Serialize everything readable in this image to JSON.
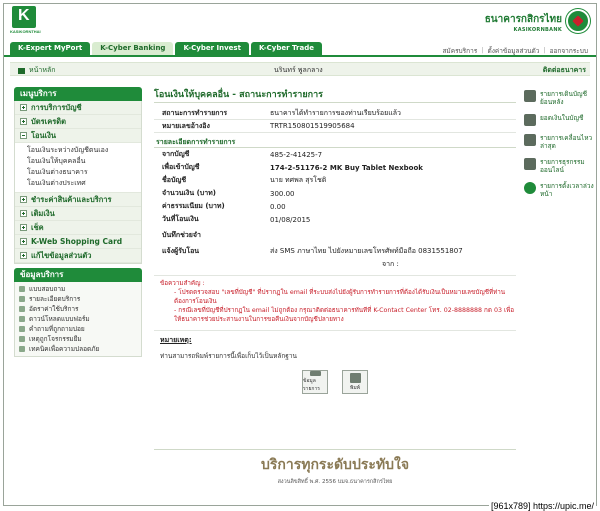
{
  "header": {
    "logo_text": "KASIKORNTHAI",
    "bank_name_th": "ธนาคารกสิกรไทย",
    "bank_name_en": "KASIKORNBANK"
  },
  "tabs": [
    {
      "label": "K-Expert MyPort"
    },
    {
      "label": "K-Cyber Banking"
    },
    {
      "label": "K-Cyber Invest"
    },
    {
      "label": "K-Cyber Trade"
    }
  ],
  "top_links": [
    "สมัครบริการ",
    "ตั้งค่าข้อมูลส่วนตัว",
    "ออกจากระบบ"
  ],
  "subbar": {
    "home": "หน้าหลัก",
    "user": "นรินทร์ พูลกลาง",
    "contact": "ติดต่อธนาคาร"
  },
  "sidebar": {
    "menu_title": "เมนูบริการ",
    "items": [
      {
        "label": "การบริการบัญชี"
      },
      {
        "label": "บัตรเครดิต"
      },
      {
        "label": "โอนเงิน"
      }
    ],
    "transfer_sub": [
      "โอนเงินระหว่างบัญชีตนเอง",
      "โอนเงินให้บุคคลอื่น",
      "โอนเงินต่างธนาคาร",
      "โอนเงินต่างประเทศ"
    ],
    "items2": [
      {
        "label": "ชำระค่าสินค้าและบริการ"
      },
      {
        "label": "เติมเงิน"
      },
      {
        "label": "เช็ค"
      },
      {
        "label": "K-Web Shopping Card"
      },
      {
        "label": "แก้ไขข้อมูลส่วนตัว"
      }
    ],
    "service_title": "ข้อมูลบริการ",
    "services": [
      "แบบสอบถาม",
      "รายละเอียดบริการ",
      "อัตราค่าใช้บริการ",
      "ดาวน์โหลดแบบฟอร์ม",
      "คำถามที่ถูกถามบ่อย",
      "เหตุถูกโจรกรรมยืม",
      "เทคนิคเพื่อความปลอดภัย"
    ]
  },
  "main": {
    "title": "โอนเงินให้บุคคลอื่น - สถานะการทำรายการ",
    "status_label": "สถานะการทำรายการ",
    "status_value": "ธนาคารได้ทำรายการของท่านเรียบร้อยแล้ว",
    "ref_label": "หมายเลขอ้างอิง",
    "ref_value": "TRTR150801519905684",
    "detail_title": "รายละเอียดการทำรายการ",
    "fields": [
      {
        "k": "จากบัญชี",
        "v": "485-2-41425-7"
      },
      {
        "k": "เพื่อเข้าบัญชี",
        "v": "174-2-51176-2 MK Buy Tablet Nexbook"
      },
      {
        "k": "ชื่อบัญชี",
        "v": "นาย ทศพล สุรโชติ"
      },
      {
        "k": "จำนวนเงิน (บาท)",
        "v": "300.00"
      },
      {
        "k": "ค่าธรรมเนียม (บาท)",
        "v": "0.00"
      },
      {
        "k": "วันที่โอนเงิน",
        "v": "01/08/2015"
      },
      {
        "k": "บันทึกช่วยจำ",
        "v": ""
      },
      {
        "k": "แจ้งผู้รับโอน",
        "v": "ส่ง SMS ภาษาไทย ไปยังหมายเลขโทรศัพท์มือถือ 0831551807"
      }
    ],
    "notify_from_label": "จาก :",
    "note_title": "ข้อความสำคัญ :",
    "note_1": "- โปรดตรวจสอบ \"เลขที่บัญชี\" ที่ปรากฏใน email ที่ระบบส่งไปยังผู้รับการทำรายการที่ต้องได้รับเงินเป็นหมายเลขบัญชีที่ท่านต้องการโอนเงิน",
    "note_2": "- กรณีเลขที่บัญชีที่ปรากฏใน email ไม่ถูกต้อง กรุณาติดต่อธนาคารทันทีที่ K-Contact Center โทร. 02-8888888 กด 03 เพื่อให้ธนาคารช่วยประสานงานในการขอคืนเงินจากบัญชีปลายทาง",
    "remark_title": "หมายเหตุ:",
    "remark_text": "ท่านสามารถพิมพ์รายการนี้เพื่อเก็บไว้เป็นหลักฐาน",
    "btn_save": "ข้อมูลรายการ",
    "btn_print": "พิมพ์"
  },
  "footer": {
    "slogan": "บริการทุกระดับประทับใจ",
    "copyright": "สงวนลิขสิทธิ์ พ.ศ. 2556 บมจ.ธนาคารกสิกรไทย"
  },
  "right_panel": [
    {
      "label": "รายการเดินบัญชีย้อนหลัง"
    },
    {
      "label": "ยอดเงินในบัญชี"
    },
    {
      "label": "รายการเคลื่อนไหวล่าสุด"
    },
    {
      "label": "รายการธุรกรรมออนไลน์"
    },
    {
      "label": "รายการตั้งเวลาล่วงหน้า"
    }
  ],
  "watermark": "[961x789] https://upic.me/"
}
